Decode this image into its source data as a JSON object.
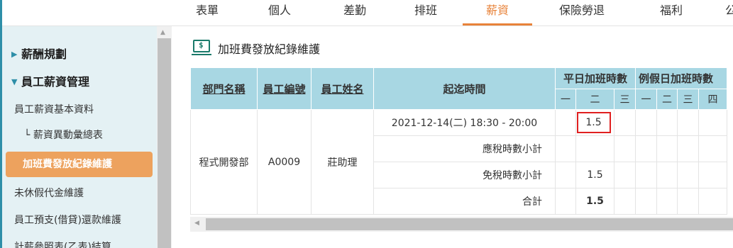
{
  "top_nav": {
    "tabs": [
      {
        "label": "表單"
      },
      {
        "label": "個人"
      },
      {
        "label": "差勤"
      },
      {
        "label": "排班"
      },
      {
        "label": "薪資",
        "active": true
      },
      {
        "label": "保險勞退"
      },
      {
        "label": "福利"
      },
      {
        "label": "公"
      }
    ],
    "accent_color": "#e8833a"
  },
  "sidebar": {
    "sections": [
      {
        "label": "薪酬規劃",
        "icon": "triangle-right-icon"
      },
      {
        "label": "員工薪資管理",
        "icon": "triangle-down-icon"
      }
    ],
    "items": [
      {
        "label": "員工薪資基本資料"
      },
      {
        "label": "└ 薪資異動彙總表"
      },
      {
        "label": "加班費發放紀錄維護",
        "active": true
      },
      {
        "label": "未休假代金維護"
      },
      {
        "label": "員工預支(借貸)還款維護"
      },
      {
        "label": "計薪參照表(乙表)結算"
      }
    ],
    "active_color": "#eda25e"
  },
  "page": {
    "icon": "money-icon",
    "icon_text": "$",
    "title": "加班費發放紀錄維護"
  },
  "table": {
    "headers": {
      "dept": "部門名稱",
      "emp_no": "員工編號",
      "emp_name": "員工姓名",
      "period": "起迄時間",
      "weekday_ot": "平日加班時數",
      "holiday_ot": "例假日加班時數"
    },
    "weekday_days": [
      "一",
      "二",
      "三"
    ],
    "holiday_days": [
      "一",
      "二",
      "三",
      "四"
    ],
    "row": {
      "dept": "程式開發部",
      "emp_no": "A0009",
      "emp_name": "莊助理",
      "period": "2021-12-14(二) 18:30 - 20:00",
      "weekday_tue": "1.5"
    },
    "subtotals": [
      {
        "label": "應稅時數小計",
        "weekday_tue": ""
      },
      {
        "label": "免稅時數小計",
        "weekday_tue": "1.5"
      },
      {
        "label": "合計",
        "weekday_tue": "1.5"
      }
    ]
  }
}
